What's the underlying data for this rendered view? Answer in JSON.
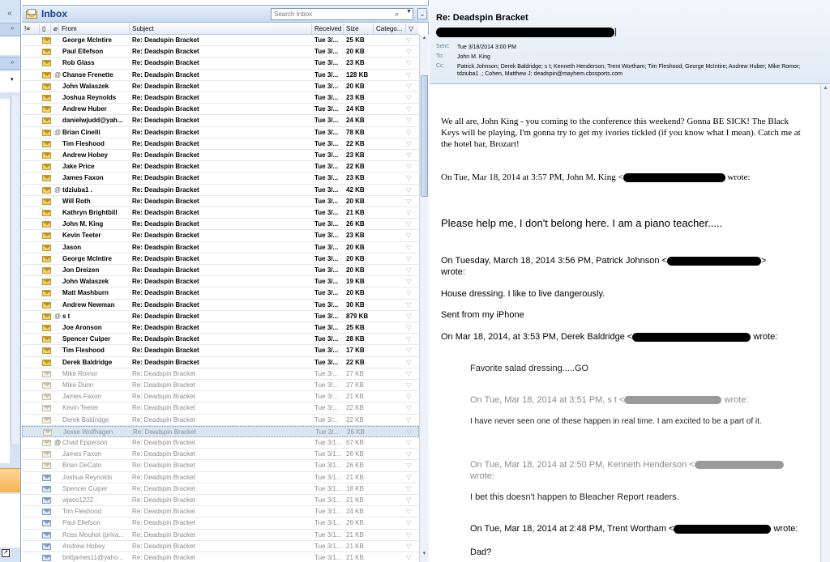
{
  "list": {
    "title": "Inbox",
    "search_placeholder": "Search Inbox",
    "columns": {
      "from": "From",
      "subject": "Subject",
      "received": "Received",
      "size": "Size",
      "categories": "Catego..."
    },
    "rows": [
      {
        "from": "George McIntire",
        "subject": "Re: Deadspin Bracket",
        "received": "Tue 3/...",
        "size": "25 KB",
        "state": "unread",
        "attach": false
      },
      {
        "from": "Paul Ellefson",
        "subject": "Re: Deadspin Bracket",
        "received": "Tue 3/...",
        "size": "20 KB",
        "state": "unread",
        "attach": false
      },
      {
        "from": "Rob Glass",
        "subject": "Re: Deadspin Bracket",
        "received": "Tue 3/...",
        "size": "23 KB",
        "state": "unread",
        "attach": false
      },
      {
        "from": "Chanse Frenette",
        "subject": "Re: Deadspin Bracket",
        "received": "Tue 3/...",
        "size": "128 KB",
        "state": "unread",
        "attach": true
      },
      {
        "from": "John Walaszek",
        "subject": "Re: Deadspin Bracket",
        "received": "Tue 3/...",
        "size": "20 KB",
        "state": "unread",
        "attach": false
      },
      {
        "from": "Joshua Reynolds",
        "subject": "Re: Deadspin Bracket",
        "received": "Tue 3/...",
        "size": "23 KB",
        "state": "unread",
        "attach": false
      },
      {
        "from": "Andrew Huber",
        "subject": "Re: Deadspin Bracket",
        "received": "Tue 3/...",
        "size": "24 KB",
        "state": "unread",
        "attach": false
      },
      {
        "from": "danielwjudd@yah...",
        "subject": "Re: Deadspin Bracket",
        "received": "Tue 3/...",
        "size": "24 KB",
        "state": "unread",
        "attach": false
      },
      {
        "from": "Brian Cinelli",
        "subject": "Re: Deadspin Bracket",
        "received": "Tue 3/...",
        "size": "78 KB",
        "state": "unread",
        "attach": true
      },
      {
        "from": "Tim Fleshood",
        "subject": "Re: Deadspin Bracket",
        "received": "Tue 3/...",
        "size": "22 KB",
        "state": "unread",
        "attach": false
      },
      {
        "from": "Andrew Hobey",
        "subject": "Re: Deadspin Bracket",
        "received": "Tue 3/...",
        "size": "23 KB",
        "state": "unread",
        "attach": false
      },
      {
        "from": "Jake Price",
        "subject": "Re: Deadspin Bracket",
        "received": "Tue 3/...",
        "size": "22 KB",
        "state": "unread",
        "attach": false
      },
      {
        "from": "James Faxon",
        "subject": "Re: Deadspin Bracket",
        "received": "Tue 3/...",
        "size": "23 KB",
        "state": "unread",
        "attach": false
      },
      {
        "from": "tdziuba1 .",
        "subject": "Re: Deadspin Bracket",
        "received": "Tue 3/...",
        "size": "42 KB",
        "state": "unread",
        "attach": true
      },
      {
        "from": "Will Roth",
        "subject": "Re: Deadspin Bracket",
        "received": "Tue 3/...",
        "size": "20 KB",
        "state": "unread",
        "attach": false
      },
      {
        "from": "Kathryn Brightbill",
        "subject": "Re: Deadspin Bracket",
        "received": "Tue 3/...",
        "size": "21 KB",
        "state": "unread",
        "attach": false
      },
      {
        "from": "John M. King",
        "subject": "Re: Deadspin Bracket",
        "received": "Tue 3/...",
        "size": "26 KB",
        "state": "unread",
        "attach": false
      },
      {
        "from": "Kevin Teeter",
        "subject": "Re: Deadspin Bracket",
        "received": "Tue 3/...",
        "size": "23 KB",
        "state": "unread",
        "attach": false
      },
      {
        "from": "Jason",
        "subject": "Re: Deadspin Bracket",
        "received": "Tue 3/...",
        "size": "20 KB",
        "state": "unread",
        "attach": false
      },
      {
        "from": "George McIntire",
        "subject": "Re: Deadspin Bracket",
        "received": "Tue 3/...",
        "size": "20 KB",
        "state": "unread",
        "attach": false
      },
      {
        "from": "Jon Dreizen",
        "subject": "Re: Deadspin Bracket",
        "received": "Tue 3/...",
        "size": "20 KB",
        "state": "unread",
        "attach": false
      },
      {
        "from": "John Walaszek",
        "subject": "Re: Deadspin Bracket",
        "received": "Tue 3/...",
        "size": "19 KB",
        "state": "unread",
        "attach": false
      },
      {
        "from": "Matt Mashburn",
        "subject": "Re: Deadspin Bracket",
        "received": "Tue 3/...",
        "size": "20 KB",
        "state": "unread",
        "attach": false
      },
      {
        "from": "Andrew Newman",
        "subject": "Re: Deadspin Bracket",
        "received": "Tue 3/...",
        "size": "30 KB",
        "state": "unread",
        "attach": false
      },
      {
        "from": "s t",
        "subject": "Re: Deadspin Bracket",
        "received": "Tue 3/...",
        "size": "879 KB",
        "state": "unread",
        "attach": true
      },
      {
        "from": "Joe Aronson",
        "subject": "Re: Deadspin Bracket",
        "received": "Tue 3/...",
        "size": "25 KB",
        "state": "unread",
        "attach": false
      },
      {
        "from": "Spencer Cuiper",
        "subject": "Re: Deadspin Bracket",
        "received": "Tue 3/...",
        "size": "28 KB",
        "state": "unread",
        "attach": false
      },
      {
        "from": "Tim Fleshood",
        "subject": "Re: Deadspin Bracket",
        "received": "Tue 3/...",
        "size": "17 KB",
        "state": "unread",
        "attach": false
      },
      {
        "from": "Derek Baldridge",
        "subject": "Re: Deadspin Bracket",
        "received": "Tue 3/...",
        "size": "22 KB",
        "state": "unread",
        "attach": false
      },
      {
        "from": "Mike Romor",
        "subject": "Re: Deadspin Bracket",
        "received": "Tue 3/...",
        "size": "27 KB",
        "state": "read",
        "attach": false
      },
      {
        "from": "Mike Dunn",
        "subject": "Re: Deadspin Bracket",
        "received": "Tue 3/...",
        "size": "27 KB",
        "state": "read",
        "attach": false
      },
      {
        "from": "James Faxon",
        "subject": "Re: Deadspin Bracket",
        "received": "Tue 3/...",
        "size": "21 KB",
        "state": "read",
        "attach": false
      },
      {
        "from": "Kevin Teeter",
        "subject": "Re: Deadspin Bracket",
        "received": "Tue 3/...",
        "size": "22 KB",
        "state": "read",
        "attach": false
      },
      {
        "from": "Derek Baldridge",
        "subject": "Re: Deadspin Bracket",
        "received": "Tue 3/...",
        "size": "22 KB",
        "state": "read",
        "attach": false
      },
      {
        "from": "Jesse Wolfhagen",
        "subject": "Re: Deadspin Bracket",
        "received": "Tue 3/...",
        "size": "26 KB",
        "state": "selected",
        "attach": false
      },
      {
        "from": "Chad Epperson",
        "subject": "Re: Deadspin Bracket",
        "received": "Tue 3/1...",
        "size": "67 KB",
        "state": "read",
        "attach": true
      },
      {
        "from": "James Faxon",
        "subject": "Re: Deadspin Bracket",
        "received": "Tue 3/1...",
        "size": "26 KB",
        "state": "read",
        "attach": false
      },
      {
        "from": "Brian DeCato",
        "subject": "Re: Deadspin Bracket",
        "received": "Tue 3/1...",
        "size": "26 KB",
        "state": "read",
        "attach": false
      },
      {
        "from": "Joshua Reynolds",
        "subject": "Re: Deadspin Bracket",
        "received": "Tue 3/1...",
        "size": "21 KB",
        "state": "replied",
        "attach": false
      },
      {
        "from": "Spencer Cuiper",
        "subject": "Re: Deadspin Bracket",
        "received": "Tue 3/1...",
        "size": "18 KB",
        "state": "replied",
        "attach": false
      },
      {
        "from": "wjaco1222 .",
        "subject": "Re: Deadspin Bracket",
        "received": "Tue 3/1...",
        "size": "21 KB",
        "state": "replied",
        "attach": false
      },
      {
        "from": "Tim Fleshood",
        "subject": "Re: Deadspin Bracket",
        "received": "Tue 3/1...",
        "size": "24 KB",
        "state": "replied",
        "attach": false
      },
      {
        "from": "Paul Ellefson",
        "subject": "Re: Deadspin Bracket",
        "received": "Tue 3/1...",
        "size": "26 KB",
        "state": "replied",
        "attach": false
      },
      {
        "from": "Ross Mouhot (priva...",
        "subject": "Re: Deadspin Bracket",
        "received": "Tue 3/1...",
        "size": "21 KB",
        "state": "replied",
        "attach": false
      },
      {
        "from": "Andrew Hobey",
        "subject": "Re: Deadspin Bracket",
        "received": "Tue 3/1...",
        "size": "21 KB",
        "state": "replied",
        "attach": false
      },
      {
        "from": "brittjames11@yaho...",
        "subject": "Re: Deadspin Bracket",
        "received": "Tue 3/1...",
        "size": "21 KB",
        "state": "replied",
        "attach": false
      }
    ]
  },
  "reader": {
    "subject": "Re: Deadspin Bracket",
    "from_suffix": "]",
    "sent_label": "Sent:",
    "sent_value": "Tue 3/18/2014 3:00 PM",
    "to_label": "To:",
    "to_value": "John M. King",
    "cc_label": "Cc:",
    "cc_value": "Patrick Johnson; Derek Baldridge; s t; Kenneth Henderson; Trent Wortham; Tim Fleshood; George McIntire; Andrew Huber; Mike Romor; tdziuba1 .; Cohen, Matthew J; deadspin@mayhem.cbssports.com",
    "body": {
      "p1": "We all are, John King - you coming to the conference this weekend? Gonna BE SICK! The Black Keys will be playing, I'm gonna try to get my ivories tickled (if you know what I mean). Catch me at the hotel bar, Brozart!",
      "q1_prefix": "On Tue, Mar 18, 2014 at 3:57 PM, John M. King <",
      "q1_suffix": "wrote:",
      "p2": "Please help me, I don't belong here. I am a piano teacher.....",
      "q2_prefix": "On Tuesday, March 18, 2014 3:56 PM, Patrick Johnson <",
      "q2_suffix": "wrote:",
      "p3": "House dressing. I like to live dangerously.",
      "p4": "Sent from my iPhone",
      "q3_prefix": "On Mar 18, 2014, at 3:53 PM, Derek Baldridge <",
      "q3_suffix": "wrote:",
      "p5": "Favorite salad dressing.....GO",
      "q4_prefix": "On Tue, Mar 18, 2014 at 3:51 PM, s t <",
      "q4_suffix": "wrote:",
      "p6": "I have never seen one of these happen in real time.  I am excited to be a part of it.",
      "q5_prefix": "On Tue, Mar 18, 2014 at 2:50 PM, Kenneth Henderson <",
      "p7": "I bet this doesn't happen to Bleacher Report readers.",
      "q6_prefix": "On Tue, Mar 18, 2014 at 2:48 PM, Trent Wortham <",
      "q6_suffix": "wrote:",
      "p8": "Dad?",
      "q5_suffix": "wrote:"
    }
  }
}
